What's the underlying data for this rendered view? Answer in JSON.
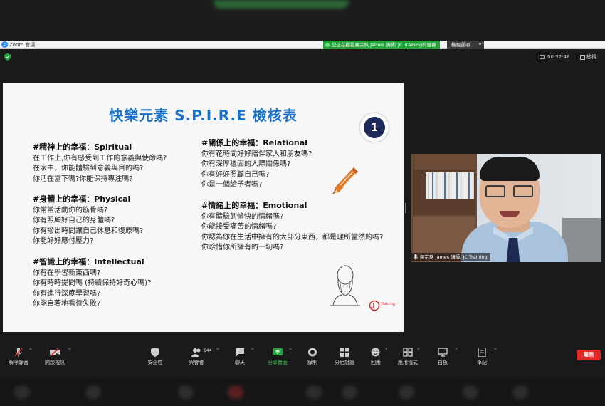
{
  "titlebar": {
    "app_title": "Zoom 會議"
  },
  "share_banner": {
    "text": "您正在觀看蔣宗銘 James 講師/ JC Training的螢幕",
    "view_options": "檢視選項"
  },
  "header": {
    "timer": "00:32:48",
    "view_label": "檢視"
  },
  "slide": {
    "title": "快樂元素 S.P.I.R.E 檢核表",
    "number": "1",
    "sections": [
      {
        "heading": "#精神上的幸福：Spiritual",
        "lines": [
          "在工作上,你有感受到工作的意義與使命嗎?",
          "在家中，你能體驗到意義與目的嗎?",
          "你活在當下嗎?你能保持專注嗎?"
        ]
      },
      {
        "heading": "#身體上的幸福：Physical",
        "lines": [
          "你常常活動你的筋骨嗎?",
          "你有照顧好自己的身體嗎?",
          "你有撥出時間讓自己休息和復原嗎?",
          "你能好好應付壓力?"
        ]
      },
      {
        "heading": "#智識上的幸福：Intellectual",
        "lines": [
          "你有在學習新東西嗎?",
          "你有時時提問嗎 (持續保持好奇心嗎)?",
          "你有進行深度學習嗎?",
          "你能自若地看待失敗?"
        ]
      },
      {
        "heading": "#關係上的幸福：Relational",
        "lines": [
          "你有花時間好好陪伴家人和朋友嗎?",
          "你有深厚穩固的人際關係嗎?",
          "你有好好照顧自己嗎?",
          "你是一個給予者嗎?"
        ]
      },
      {
        "heading": "#情緒上的幸福：Emotional",
        "lines": [
          "你有體驗到愉快的情緒嗎?",
          "你能接受痛苦的情緒嗎?",
          "你認為你在生活中擁有的大部分東西，都是理所當然的嗎?",
          "你珍惜你所擁有的一切嗎?"
        ]
      }
    ],
    "logo_text": "Training"
  },
  "video": {
    "name_tag": "蔣宗銘 James 講師/ JC Training"
  },
  "toolbar": {
    "unmute": "解除靜音",
    "start_video": "開啟視訊",
    "security": "安全性",
    "participants": "與會者",
    "participants_count": "144",
    "chat": "聊天",
    "share_screen": "分享畫面",
    "record": "錄制",
    "breakout": "分組討論",
    "reactions": "回應",
    "apps": "應用程式",
    "whiteboard": "白板",
    "notes": "筆記",
    "leave": "離開"
  },
  "colors": {
    "accent_green": "#23a339",
    "title_blue": "#1a73c9",
    "leave_red": "#e02828"
  }
}
